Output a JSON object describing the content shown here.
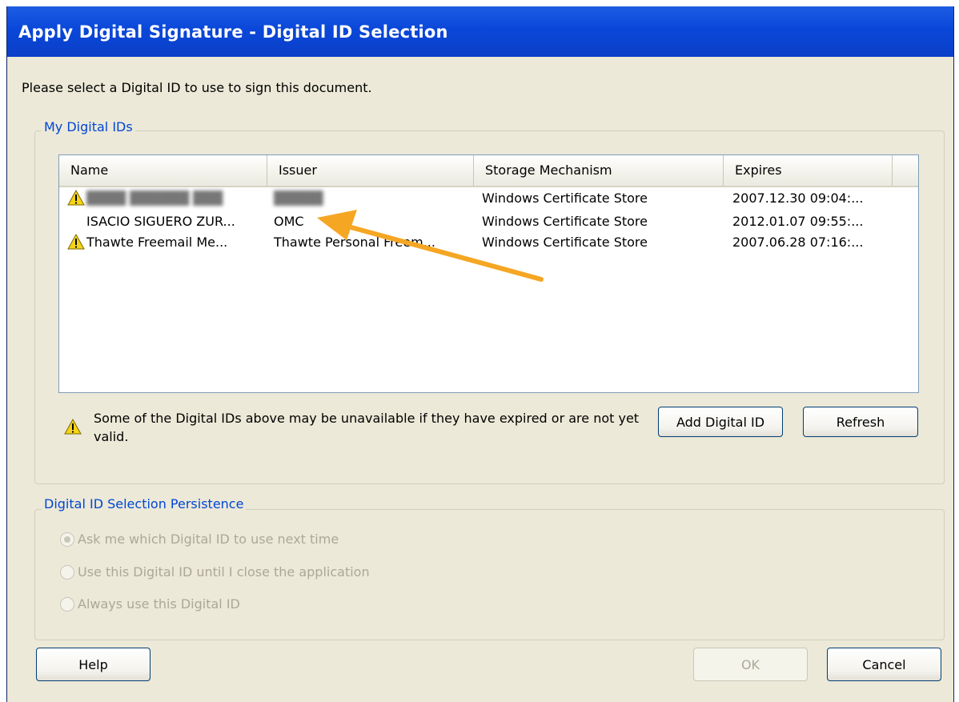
{
  "window": {
    "title": "Apply Digital Signature - Digital ID Selection"
  },
  "instruction": "Please select a Digital ID to use to sign this document.",
  "my_ids": {
    "legend": "My Digital IDs",
    "columns": [
      "Name",
      "Issuer",
      "Storage Mechanism",
      "Expires"
    ],
    "rows": [
      {
        "warning": true,
        "name": "████ ██████ ███",
        "issuer": "█████",
        "storage": "Windows Certificate Store",
        "expires": "2007.12.30 09:04:..."
      },
      {
        "warning": false,
        "name": "ISACIO SIGUERO ZUR...",
        "issuer": "OMC",
        "storage": "Windows Certificate Store",
        "expires": "2012.01.07 09:55:..."
      },
      {
        "warning": true,
        "name": "Thawte Freemail Me...",
        "issuer": "Thawte Personal Freem...",
        "storage": "Windows Certificate Store",
        "expires": "2007.06.28 07:16:..."
      }
    ],
    "warning_text": "Some of the Digital IDs above may be unavailable if they have expired or are not yet valid.",
    "add_button": "Add Digital ID",
    "refresh_button": "Refresh"
  },
  "persistence": {
    "legend": "Digital ID Selection Persistence",
    "options": [
      {
        "label": "Ask me which Digital ID to use next time",
        "selected": true
      },
      {
        "label": "Use this Digital ID until I close the application",
        "selected": false
      },
      {
        "label": "Always use this Digital ID",
        "selected": false
      }
    ]
  },
  "buttons": {
    "help": "Help",
    "ok": "OK",
    "cancel": "Cancel"
  },
  "colors": {
    "titlebar": "#0a47d9",
    "legend_text": "#0046d5",
    "annotation_arrow": "#f5a623",
    "warning_icon": "#f7d417"
  },
  "icons": {
    "warning": "warning-triangle-icon",
    "annotation": "arrow-icon"
  }
}
